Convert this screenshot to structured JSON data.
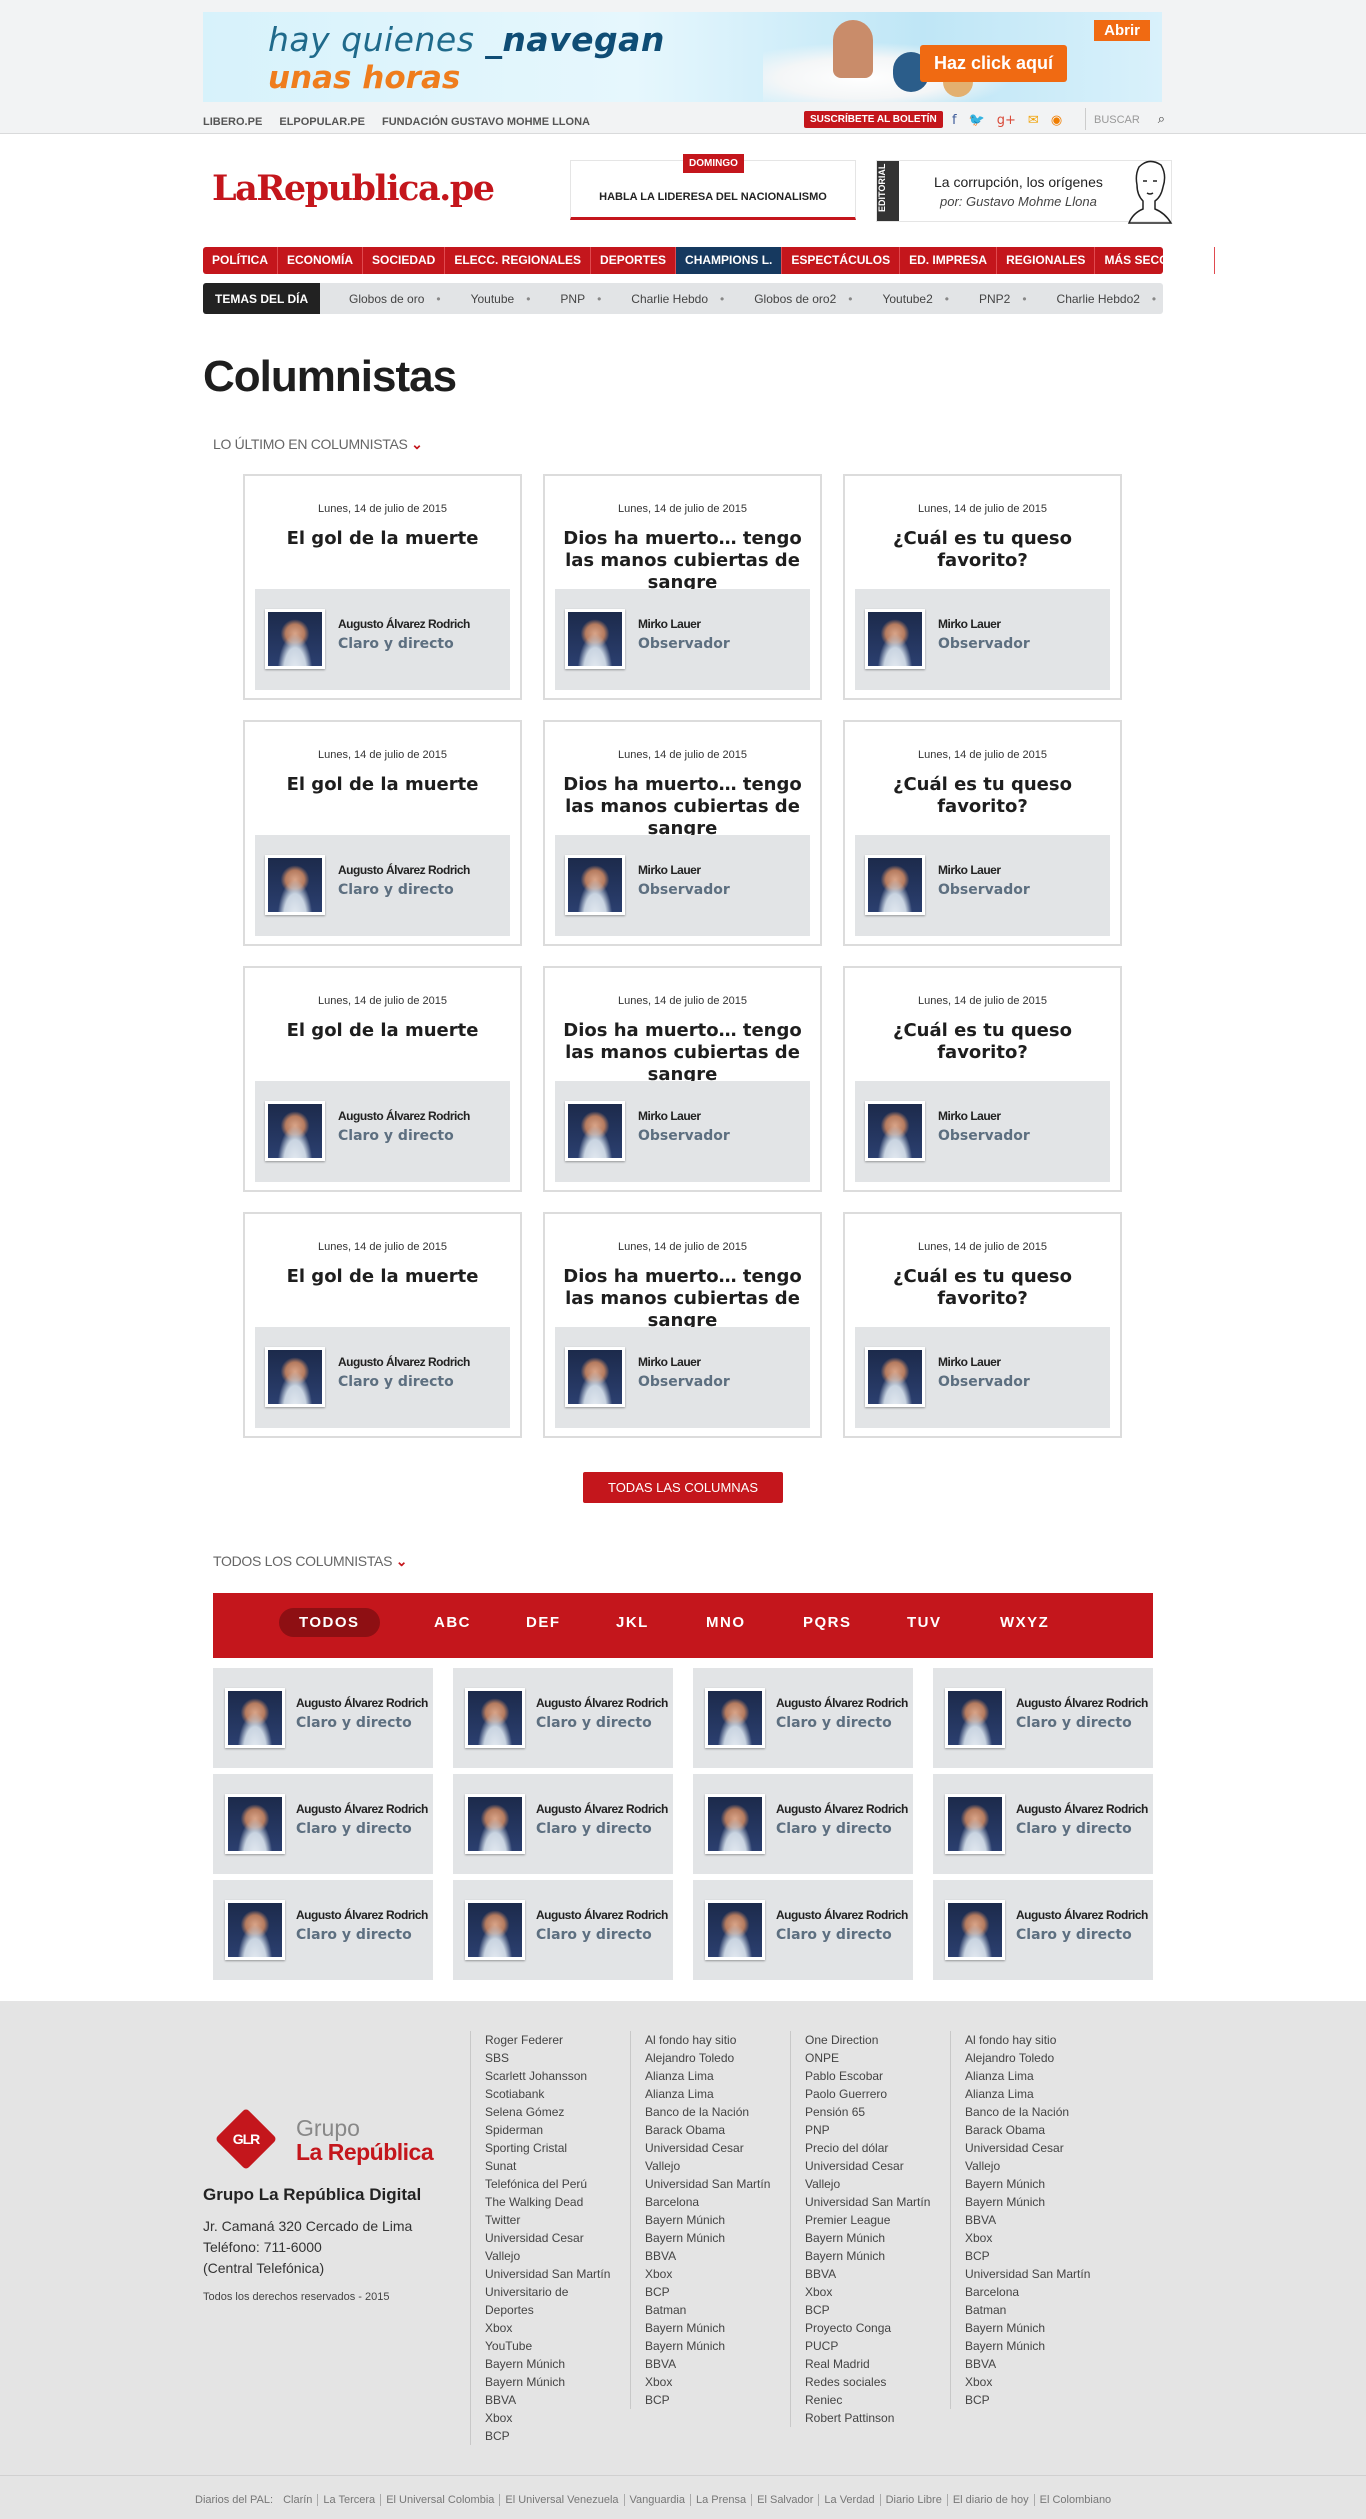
{
  "ad": {
    "line1_prefix": "hay quienes ",
    "line1_bold": "_navegan",
    "line2": "unas horas",
    "abrir": "Abrir",
    "cta": "Haz click aquí"
  },
  "util": {
    "links": [
      "LIBERO.PE",
      "ELPOPULAR.PE",
      "FUNDACIÓN GUSTAVO MOHME LLONA"
    ],
    "subscribe": "SUSCRÍBETE AL BOLETÍN",
    "social": [
      {
        "icon": "facebook-icon",
        "glyph": "f",
        "color": "#3b5998"
      },
      {
        "icon": "twitter-icon",
        "glyph": "🐦",
        "color": "#2aa3dc"
      },
      {
        "icon": "googleplus-icon",
        "glyph": "g+",
        "color": "#d94a38"
      },
      {
        "icon": "mail-icon",
        "glyph": "✉",
        "color": "#f0a30a"
      },
      {
        "icon": "rss-icon",
        "glyph": "◉",
        "color": "#f07d00"
      }
    ],
    "search_placeholder": "BUSCAR"
  },
  "header": {
    "logo": "LaRepublica.pe",
    "domingo": {
      "tag": "DOMINGO",
      "text": "HABLA LA LIDERESA DEL NACIONALISMO"
    },
    "editorial": {
      "side": "EDITORIAL",
      "title": "La corrupción, los orígenes",
      "byline": "por: Gustavo Mohme Llona"
    }
  },
  "nav": {
    "items": [
      "POLÍTICA",
      "ECONOMÍA",
      "SOCIEDAD",
      "ELECC. REGIONALES",
      "DEPORTES",
      "CHAMPIONS L.",
      "ESPECTÁCULOS",
      "ED. IMPRESA",
      "REGIONALES",
      "MÁS SECCIONES"
    ],
    "active": "CHAMPIONS L."
  },
  "temas": {
    "label": "TEMAS DEL DÍA",
    "items": [
      "Globos de oro",
      "Youtube",
      "PNP",
      "Charlie Hebdo",
      "Globos de oro2",
      "Youtube2",
      "PNP2",
      "Charlie Hebdo2"
    ]
  },
  "page": {
    "title": "Columnistas",
    "latest_heading": "LO ÚLTIMO EN COLUMNISTAS",
    "all_button": "TODAS LAS COLUMNAS",
    "all_heading": "TODOS LOS COLUMNISTAS"
  },
  "latest_cards": [
    {
      "date": "Lunes, 14 de julio de 2015",
      "title": "El gol de la muerte",
      "author": "Augusto Álvarez Rodrich",
      "column": "Claro y directo"
    },
    {
      "date": "Lunes, 14 de julio de 2015",
      "title": "Dios ha muerto… tengo las manos cubiertas de sangre",
      "author": "Mirko Lauer",
      "column": "Observador"
    },
    {
      "date": "Lunes, 14 de julio de 2015",
      "title": "¿Cuál es tu queso favorito?",
      "author": "Mirko Lauer",
      "column": "Observador"
    },
    {
      "date": "Lunes, 14 de julio de 2015",
      "title": "El gol de la muerte",
      "author": "Augusto Álvarez Rodrich",
      "column": "Claro y directo"
    },
    {
      "date": "Lunes, 14 de julio de 2015",
      "title": "Dios ha muerto… tengo las manos cubiertas de sangre",
      "author": "Mirko Lauer",
      "column": "Observador"
    },
    {
      "date": "Lunes, 14 de julio de 2015",
      "title": "¿Cuál es tu queso favorito?",
      "author": "Mirko Lauer",
      "column": "Observador"
    },
    {
      "date": "Lunes, 14 de julio de 2015",
      "title": "El gol de la muerte",
      "author": "Augusto Álvarez Rodrich",
      "column": "Claro y directo"
    },
    {
      "date": "Lunes, 14 de julio de 2015",
      "title": "Dios ha muerto… tengo las manos cubiertas de sangre",
      "author": "Mirko Lauer",
      "column": "Observador"
    },
    {
      "date": "Lunes, 14 de julio de 2015",
      "title": "¿Cuál es tu queso favorito?",
      "author": "Mirko Lauer",
      "column": "Observador"
    },
    {
      "date": "Lunes, 14 de julio de 2015",
      "title": "El gol de la muerte",
      "author": "Augusto Álvarez Rodrich",
      "column": "Claro y directo"
    },
    {
      "date": "Lunes, 14 de julio de 2015",
      "title": "Dios ha muerto… tengo las manos cubiertas de sangre",
      "author": "Mirko Lauer",
      "column": "Observador"
    },
    {
      "date": "Lunes, 14 de julio de 2015",
      "title": "¿Cuál es tu queso favorito?",
      "author": "Mirko Lauer",
      "column": "Observador"
    }
  ],
  "alphabet": {
    "tabs": [
      "TODOS",
      "ABC",
      "DEF",
      "JKL",
      "MNO",
      "PQRS",
      "TUV",
      "WXYZ"
    ],
    "selected": "TODOS"
  },
  "columnists": [
    {
      "author": "Augusto Álvarez Rodrich",
      "column": "Claro y directo"
    },
    {
      "author": "Augusto Álvarez Rodrich",
      "column": "Claro y directo"
    },
    {
      "author": "Augusto Álvarez Rodrich",
      "column": "Claro y directo"
    },
    {
      "author": "Augusto Álvarez Rodrich",
      "column": "Claro y directo"
    },
    {
      "author": "Augusto Álvarez Rodrich",
      "column": "Claro y directo"
    },
    {
      "author": "Augusto Álvarez Rodrich",
      "column": "Claro y directo"
    },
    {
      "author": "Augusto Álvarez Rodrich",
      "column": "Claro y directo"
    },
    {
      "author": "Augusto Álvarez Rodrich",
      "column": "Claro y directo"
    },
    {
      "author": "Augusto Álvarez Rodrich",
      "column": "Claro y directo"
    },
    {
      "author": "Augusto Álvarez Rodrich",
      "column": "Claro y directo"
    },
    {
      "author": "Augusto Álvarez Rodrich",
      "column": "Claro y directo"
    },
    {
      "author": "Augusto Álvarez Rodrich",
      "column": "Claro y directo"
    }
  ],
  "footer": {
    "group_small": "Grupo",
    "group_big": "La República",
    "glr": "GLR",
    "name": "Grupo La República Digital",
    "address": [
      "Jr. Camaná 320 Cercado de Lima",
      "Teléfono: 711-6000",
      "(Central Telefónica)"
    ],
    "rights": "Todos los derechos reservados - 2015",
    "columns": [
      [
        "Roger Federer",
        "SBS",
        "Scarlett Johansson",
        "Scotiabank",
        "Selena Gómez",
        "Spiderman",
        "Sporting Cristal",
        "Sunat",
        "Telefónica del Perú",
        "The Walking Dead",
        "Twitter",
        "Universidad Cesar",
        "Vallejo",
        "Universidad San Martín",
        "Universitario de",
        "Deportes",
        "Xbox",
        "YouTube",
        "Bayern Múnich",
        "Bayern Múnich",
        "BBVA",
        "Xbox",
        "BCP"
      ],
      [
        "Al fondo hay sitio",
        "Alejandro Toledo",
        "Alianza Lima",
        "Alianza Lima",
        "Banco de la Nación",
        "Barack Obama",
        "Universidad Cesar",
        "Vallejo",
        "Universidad San Martín",
        "Barcelona",
        "Bayern Múnich",
        "Bayern Múnich",
        "BBVA",
        "Xbox",
        "BCP",
        "Batman",
        "Bayern Múnich",
        "Bayern Múnich",
        "BBVA",
        "Xbox",
        "BCP"
      ],
      [
        "One Direction",
        "ONPE",
        "Pablo Escobar",
        "Paolo Guerrero",
        "Pensión 65",
        "PNP",
        "Precio del dólar",
        "Universidad Cesar",
        "Vallejo",
        "Universidad San Martín",
        "Premier League",
        "Bayern Múnich",
        "Bayern Múnich",
        "BBVA",
        "Xbox",
        "BCP",
        "Proyecto Conga",
        "PUCP",
        "Real Madrid",
        "Redes sociales",
        "Reniec",
        "Robert Pattinson"
      ],
      [
        "Al fondo hay sitio",
        "Alejandro Toledo",
        "Alianza Lima",
        "Alianza Lima",
        "Banco de la Nación",
        "Barack Obama",
        "Universidad Cesar",
        "Vallejo",
        "Bayern Múnich",
        "Bayern Múnich",
        "BBVA",
        "Xbox",
        "BCP",
        "Universidad San Martín",
        "Barcelona",
        "Batman",
        "Bayern Múnich",
        "Bayern Múnich",
        "BBVA",
        "Xbox",
        "BCP"
      ]
    ],
    "pal_label": "Diarios del PAL:",
    "pal": [
      "Clarín",
      "La Tercera",
      "El Universal Colombia",
      "El Universal Venezuela",
      "Vanguardia",
      "La Prensa",
      "El Salvador",
      "La Verdad",
      "Diario Libre",
      "El diario de hoy",
      "El Colombiano"
    ]
  }
}
